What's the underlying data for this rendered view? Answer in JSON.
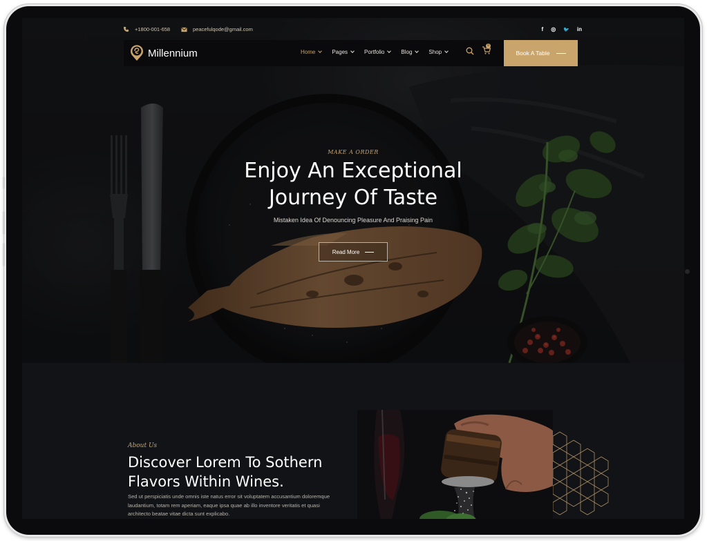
{
  "topbar": {
    "phone": "+1800-001-658",
    "email": "peacefulqode@gmail.com",
    "socials": [
      {
        "icon": "facebook-icon",
        "label": "f"
      },
      {
        "icon": "instagram-icon",
        "label": "◎"
      },
      {
        "icon": "twitter-icon",
        "label": "🐦"
      },
      {
        "icon": "linkedin-icon",
        "label": "in"
      }
    ]
  },
  "nav": {
    "brand": "Millennium",
    "items": [
      {
        "label": "Home",
        "active": true
      },
      {
        "label": "Pages"
      },
      {
        "label": "Portfolio"
      },
      {
        "label": "Blog"
      },
      {
        "label": "Shop"
      }
    ],
    "cart_count": "0",
    "cta": "Book A Table"
  },
  "hero": {
    "eyebrow": "MAKE A ORDER",
    "title_line1": "Enjoy An Exceptional",
    "title_line2": "Journey Of Taste",
    "subtitle": "Mistaken Idea Of Denouncing Pleasure And Praising Pain",
    "button": "Read More"
  },
  "about": {
    "label": "About Us",
    "title_line1": "Discover Lorem To Sothern",
    "title_line2": "Flavors Within Wines.",
    "body": "Sed ut perspiciatis unde omnis iste natus error sit voluptatem accusantium doloremque laudantium, totam rem aperiam, eaque ipsa quae ab illo inventore veritatis et quasi architecto beatae vitae dicta sunt explicabo."
  },
  "colors": {
    "accent": "#c9a56c",
    "background": "#111317",
    "nav_bg": "#0a0a0c"
  }
}
